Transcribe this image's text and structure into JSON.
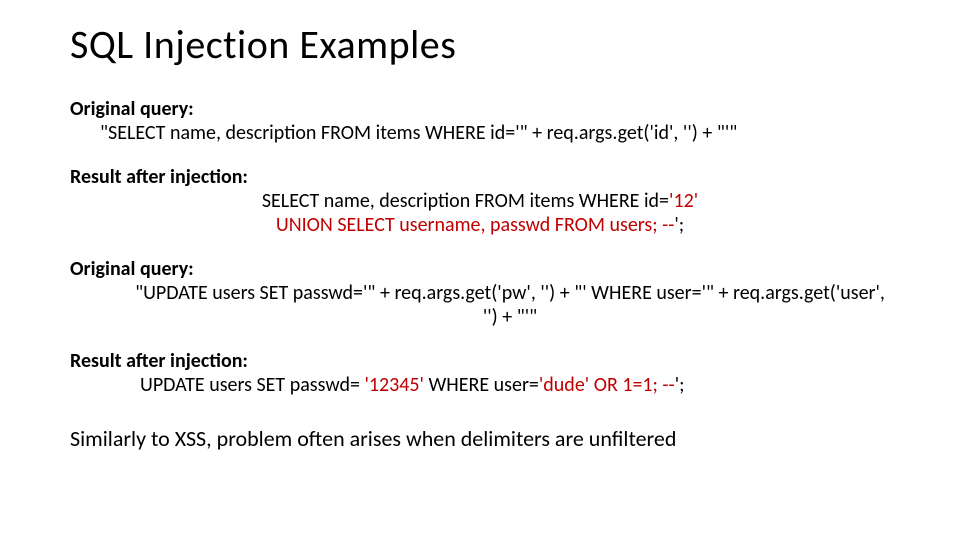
{
  "title": "SQL Injection Examples",
  "blocks": {
    "b1": {
      "label": "Original query:",
      "line1": "\"SELECT name, description FROM items WHERE id='\" + req.args.get('id', '') + \"'\""
    },
    "b2": {
      "label": "Result after injection:",
      "line1_pre": "SELECT name, description FROM items WHERE id=",
      "line1_red": "'12'",
      "line2_red": "UNION SELECT username, passwd FROM users; --",
      "line2_post": "';"
    },
    "b3": {
      "label": "Original query:",
      "line1": "\"UPDATE users SET passwd='\" + req.args.get('pw', '') + \"' WHERE user='\" + req.args.get('user', '') + \"'\""
    },
    "b4": {
      "label": "Result after injection:",
      "line1_pre": "UPDATE users SET passwd= ",
      "line1_red1": "'12345'",
      "line1_mid": " WHERE user=",
      "line1_red2": "'dude' OR 1=1; --",
      "line1_post": "';"
    }
  },
  "footer": "Similarly to XSS, problem often arises when delimiters are unfiltered"
}
